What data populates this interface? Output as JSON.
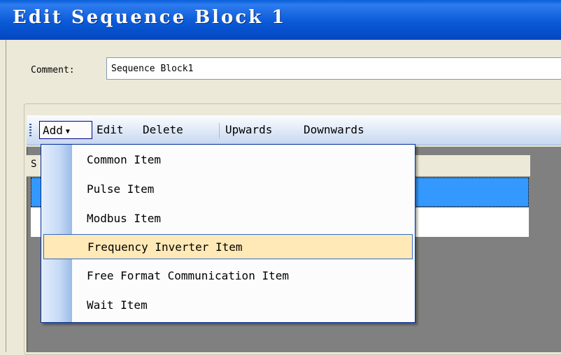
{
  "window": {
    "title": "Edit Sequence Block 1"
  },
  "comment": {
    "label": "Comment:",
    "value": "Sequence Block1"
  },
  "toolbar": {
    "add": "Add",
    "edit": "Edit",
    "delete": "Delete",
    "upwards": "Upwards",
    "downwards": "Downwards"
  },
  "grid": {
    "header_first_char": "S"
  },
  "add_menu": {
    "items": [
      "Common Item",
      "Pulse Item",
      "Modbus Item",
      "Frequency Inverter Item",
      "Free Format Communication Item",
      "Wait Item"
    ],
    "highlighted_index": 3
  },
  "colors": {
    "title_bar": "#0b5ad6",
    "selection": "#3399ff",
    "menu_highlight": "#ffe9b6",
    "menu_border": "#002d96"
  }
}
